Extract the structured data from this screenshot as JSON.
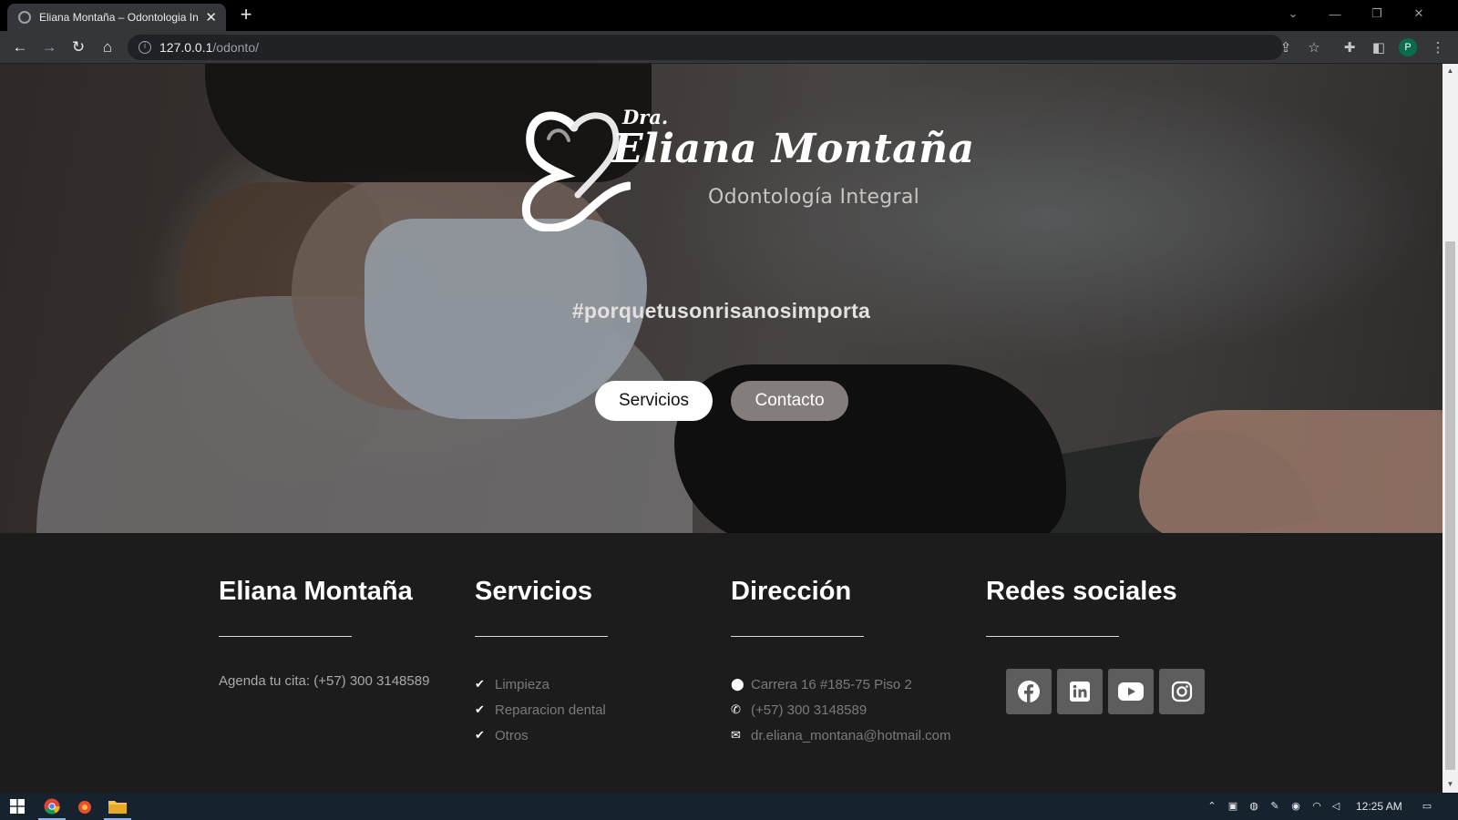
{
  "browser": {
    "tab_title": "Eliana Montaña – Odontologia In",
    "url_host": "127.0.0.1",
    "url_path": "/odonto/",
    "profile_initial": "P"
  },
  "hero": {
    "logo_prefix": "Dra.",
    "logo_name": "Eliana Montaña",
    "logo_subtitle": "Odontología Integral",
    "hashtag": "#porquetusonrisanosimporta",
    "btn_servicios": "Servicios",
    "btn_contacto": "Contacto"
  },
  "footer": {
    "brand": {
      "heading": "Eliana Montaña",
      "text": "Agenda tu cita: (+57) 300 3148589"
    },
    "services": {
      "heading": "Servicios",
      "items": [
        "Limpieza",
        "Reparacion dental",
        "Otros"
      ]
    },
    "address": {
      "heading": "Dirección",
      "street": "Carrera 16 #185-75 Piso 2",
      "phone": "(+57) 300 3148589",
      "email": "dr.eliana_montana@hotmail.com"
    },
    "social": {
      "heading": "Redes sociales",
      "networks": [
        "facebook-icon",
        "linkedin-icon",
        "youtube-icon",
        "instagram-icon"
      ]
    }
  },
  "taskbar": {
    "time": "12:25 AM"
  },
  "colors": {
    "footer_bg": "#1c1c1c",
    "contact_btn": "#837e7c",
    "social_btn": "#5d5d5d"
  }
}
